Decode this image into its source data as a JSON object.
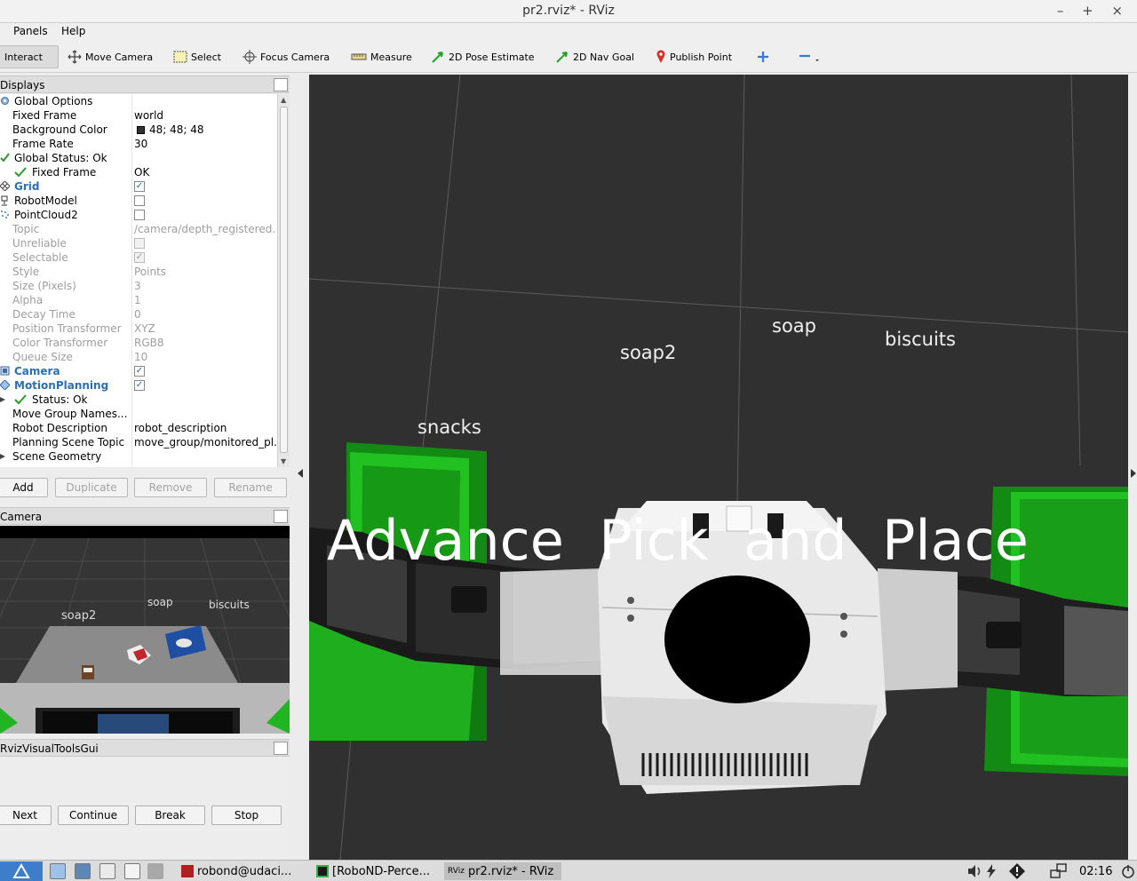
{
  "window": {
    "title": "pr2.rviz* - RViz",
    "controls": "– + ×"
  },
  "menu": {
    "panels": "Panels",
    "help": "Help"
  },
  "toolbar": {
    "interact": "Interact",
    "move_camera": "Move Camera",
    "select": "Select",
    "focus_camera": "Focus Camera",
    "measure": "Measure",
    "pose_estimate": "2D Pose Estimate",
    "nav_goal": "2D Nav Goal",
    "publish_point": "Publish Point"
  },
  "displays": {
    "title": "Displays",
    "rows": [
      {
        "name": "Global Options",
        "value": ""
      },
      {
        "name": "Fixed Frame",
        "value": "world"
      },
      {
        "name": "Background Color",
        "value": "48; 48; 48"
      },
      {
        "name": "Frame Rate",
        "value": "30"
      },
      {
        "name": "Global Status: Ok",
        "value": ""
      },
      {
        "name": "Fixed Frame",
        "value": "OK"
      },
      {
        "name": "Grid",
        "value": ""
      },
      {
        "name": "RobotModel",
        "value": ""
      },
      {
        "name": "PointCloud2",
        "value": ""
      },
      {
        "name": "Topic",
        "value": "/camera/depth_registered."
      },
      {
        "name": "Unreliable",
        "value": ""
      },
      {
        "name": "Selectable",
        "value": ""
      },
      {
        "name": "Style",
        "value": "Points"
      },
      {
        "name": "Size (Pixels)",
        "value": "3"
      },
      {
        "name": "Alpha",
        "value": "1"
      },
      {
        "name": "Decay Time",
        "value": "0"
      },
      {
        "name": "Position Transformer",
        "value": "XYZ"
      },
      {
        "name": "Color Transformer",
        "value": "RGB8"
      },
      {
        "name": "Queue Size",
        "value": "10"
      },
      {
        "name": "Camera",
        "value": ""
      },
      {
        "name": "MotionPlanning",
        "value": ""
      },
      {
        "name": "Status: Ok",
        "value": ""
      },
      {
        "name": "Move Group Names...",
        "value": ""
      },
      {
        "name": "Robot Description",
        "value": "robot_description"
      },
      {
        "name": "Planning Scene Topic",
        "value": "move_group/monitored_pl."
      },
      {
        "name": "Scene Geometry",
        "value": ""
      }
    ],
    "check_mark": "✓",
    "bg_color_hex": "#303030"
  },
  "display_buttons": {
    "add": "Add",
    "duplicate": "Duplicate",
    "remove": "Remove",
    "rename": "Rename"
  },
  "camera_panel": {
    "title": "Camera",
    "labels": {
      "soap2": "soap2",
      "soap": "soap",
      "biscuits": "biscuits"
    }
  },
  "rviz_tools": {
    "title": "RvizVisualToolsGui",
    "next": "Next",
    "continue": "Continue",
    "break": "Break",
    "stop": "Stop"
  },
  "scene": {
    "labels": {
      "snacks": "snacks",
      "soap2": "soap2",
      "soap": "soap",
      "biscuits": "biscuits"
    },
    "overlay_text": "Advance  Pick  and  Place",
    "bin_color": "#22b422"
  },
  "taskbar": {
    "terminal": "robond@udaci...",
    "pycharm": "[RoboND-Perce...",
    "rviz": "pr2.rviz* - RViz",
    "rviz_badge": "RViz",
    "clock": "02:16"
  }
}
